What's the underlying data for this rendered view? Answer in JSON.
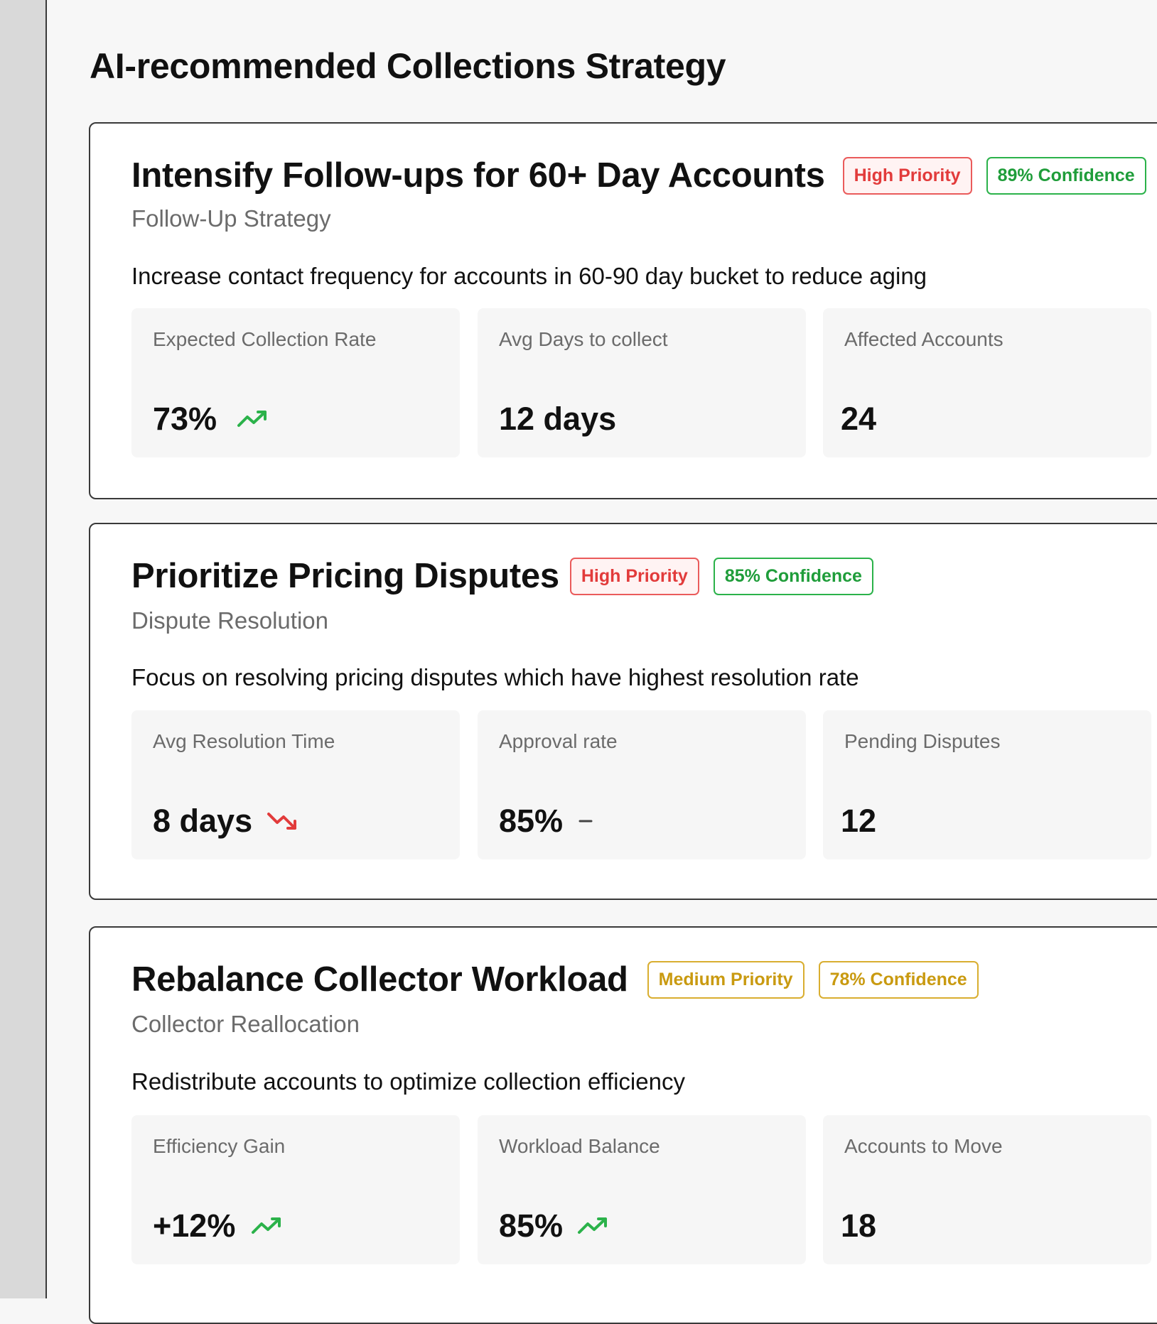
{
  "page": {
    "title": "AI-recommended Collections Strategy"
  },
  "colors": {
    "up": "#2bb24a",
    "down": "#e23b3b",
    "neutral": "#444444"
  },
  "cards": [
    {
      "title": "Intensify Follow-ups for 60+ Day Accounts",
      "priority": "High Priority",
      "confidence": "89% Confidence",
      "category": "Follow-Up Strategy",
      "description": "Increase contact frequency for accounts in 60-90 day bucket to reduce aging",
      "metrics": [
        {
          "label": "Expected Collection Rate",
          "value": "73%",
          "trend": "trending-up-icon"
        },
        {
          "label": "Avg Days to collect",
          "value": "12 days",
          "trend": ""
        },
        {
          "label": "Affected Accounts",
          "value": "24",
          "trend": ""
        }
      ]
    },
    {
      "title": "Prioritize Pricing Disputes",
      "priority": "High Priority",
      "confidence": "85% Confidence",
      "category": "Dispute Resolution",
      "description": "Focus on resolving pricing disputes which have highest resolution rate",
      "metrics": [
        {
          "label": "Avg Resolution Time",
          "value": "8 days",
          "trend": "trending-down-icon"
        },
        {
          "label": "Approval rate",
          "value": "85%",
          "trend": "neutral-dash-icon"
        },
        {
          "label": "Pending Disputes",
          "value": "12",
          "trend": ""
        }
      ]
    },
    {
      "title": "Rebalance Collector Workload",
      "priority": "Medium Priority",
      "confidence": "78% Confidence",
      "category": "Collector Reallocation",
      "description": "Redistribute accounts to optimize collection efficiency",
      "metrics": [
        {
          "label": "Efficiency Gain",
          "value": "+12%",
          "trend": "trending-up-icon"
        },
        {
          "label": "Workload Balance",
          "value": "85%",
          "trend": "trending-up-icon"
        },
        {
          "label": "Accounts to Move",
          "value": "18",
          "trend": ""
        }
      ]
    }
  ]
}
